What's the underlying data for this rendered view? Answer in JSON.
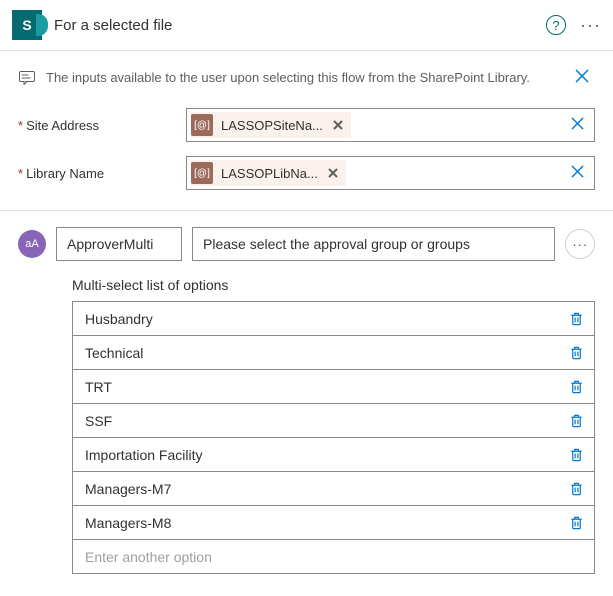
{
  "header": {
    "icon_letter": "S",
    "title": "For a selected file"
  },
  "info": {
    "text": "The inputs available to the user upon selecting this flow from the SharePoint Library."
  },
  "fields": {
    "site_address": {
      "label": "Site Address",
      "token_badge": "[@]",
      "token_text": "LASSOPSiteNa..."
    },
    "library_name": {
      "label": "Library Name",
      "token_badge": "[@]",
      "token_text": "LASSOPLibNa..."
    }
  },
  "param": {
    "avatar": "aA",
    "name": "ApproverMulti",
    "desc": "Please select the approval group or groups"
  },
  "options": {
    "label": "Multi-select list of options",
    "items": [
      "Husbandry",
      "Technical",
      "TRT",
      "SSF",
      "Importation Facility",
      "Managers-M7",
      "Managers-M8"
    ],
    "placeholder": "Enter another option"
  }
}
